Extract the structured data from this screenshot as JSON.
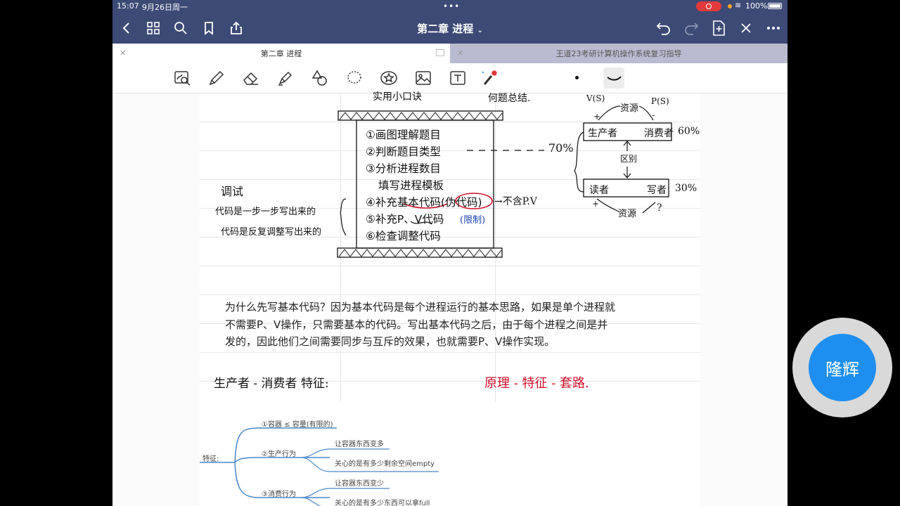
{
  "status": {
    "time": "15:07",
    "date": "9月26日周一",
    "battery": "100%"
  },
  "nav": {
    "title": "第二章 进程"
  },
  "tabs": [
    {
      "label": "第二章 进程",
      "active": true
    },
    {
      "label": "王道23考研计算机操作系统复习指导",
      "active": false
    }
  ],
  "colors": {
    "bar": "#3d4a75",
    "accent": "#1e8ff0",
    "ink_red": "#d0102a",
    "ink_blue": "#1a3fb0"
  },
  "steps": [
    "①画图理解题目",
    "②判断题目类型",
    "③分析进程数目",
    "填写进程模板",
    "④补充基本代码(伪代码)",
    "⑤补充P、V代码",
    "⑥检查调整代码"
  ],
  "handwriting": {
    "top_left": "实用小口诀",
    "top_right": "何题总结.",
    "percent70": "70%",
    "arrow_note": "→不含P.V",
    "bracket_note": "(限制)",
    "debug": "调试",
    "note1": "代码是一步一步写出来的",
    "note2": "代码是反复调整写出来的",
    "vs": "V(S)",
    "ps": "P(S)",
    "resource1": "资源",
    "producer": "生产者",
    "consumer": "消费者",
    "pct60": "60%",
    "diff": "区别",
    "reader": "读者",
    "writer": "写者",
    "pct30": "30%",
    "resource2": "资源",
    "plus1": "+",
    "minus1": "-",
    "plus2": "+",
    "q": "?",
    "heading": "生产者 - 消费者 特征:",
    "red_heading": "原理 - 特征 - 套路."
  },
  "paragraph": [
    "为什么先写基本代码？因为基本代码是每个进程运行的基本思路，如果是单个进程就",
    "不需要P、V操作，只需要基本的代码。写出基本代码之后，由于每个进程之间是并",
    "发的，因此他们之间需要同步与互斥的效果，也就需要P、V操作实现。"
  ],
  "mindmap": {
    "root": "特征:",
    "n1": "①容器 ≤ 容量(有限的)",
    "n2": "②生产行为",
    "n2a": "让容器东西变多",
    "n2b": "关心的是有多少剩余空间empty",
    "n3": "③消费行为",
    "n3a": "让容器东西变少",
    "n3b": "关心的是有多少东西可以拿full"
  },
  "floating": {
    "label": "隆辉"
  }
}
